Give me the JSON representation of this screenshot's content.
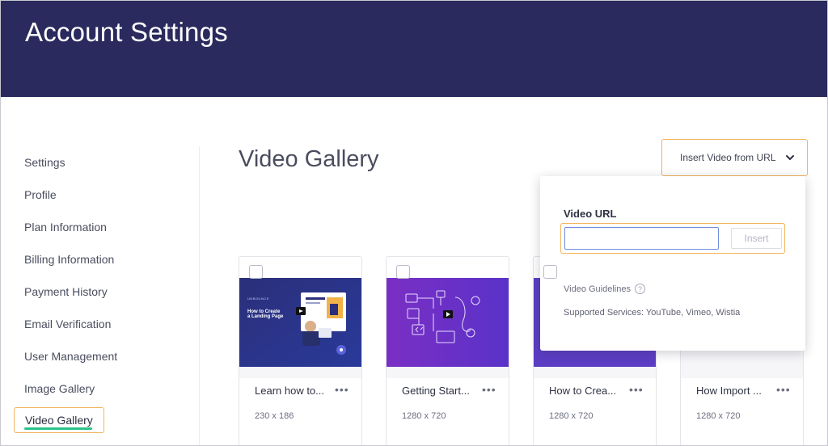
{
  "header": {
    "title": "Account Settings"
  },
  "sidebar": {
    "items": [
      {
        "label": "Settings"
      },
      {
        "label": "Profile"
      },
      {
        "label": "Plan Information"
      },
      {
        "label": "Billing Information"
      },
      {
        "label": "Payment History"
      },
      {
        "label": "Email Verification"
      },
      {
        "label": "User Management"
      },
      {
        "label": "Image Gallery"
      },
      {
        "label": "Video Gallery",
        "active": true
      }
    ]
  },
  "main": {
    "title": "Video Gallery",
    "insert_button": {
      "label": "Insert Video from URL",
      "icon": "chevron-down-icon"
    },
    "cards": [
      {
        "name": "Learn how to create a landing page",
        "display_name": "Learn how to...",
        "dims": "230 x 186",
        "thumb": {
          "brand": "UNBOUNCE",
          "headline_line1": "How to Create",
          "headline_line2": "a Landing Page"
        }
      },
      {
        "name": "Getting Started",
        "display_name": "Getting Start...",
        "dims": "1280 x 720"
      },
      {
        "name": "How to Create",
        "display_name": "How to Crea...",
        "dims": "1280 x 720"
      },
      {
        "name": "How Import",
        "display_name": "How Import ...",
        "dims": "1280 x 720"
      }
    ],
    "more_icon_text": "•••"
  },
  "popover": {
    "label": "Video URL",
    "input": {
      "value": "",
      "placeholder": ""
    },
    "insert_label": "Insert",
    "guidelines": "Video Guidelines",
    "guidelines_icon": "?",
    "supported": "Supported Services: YouTube, Vimeo, Wistia"
  },
  "colors": {
    "header_bg": "#2a2a5e",
    "highlight": "#f3b45c",
    "active_underline": "#2bc48a",
    "input_border": "#6f8bdc"
  }
}
